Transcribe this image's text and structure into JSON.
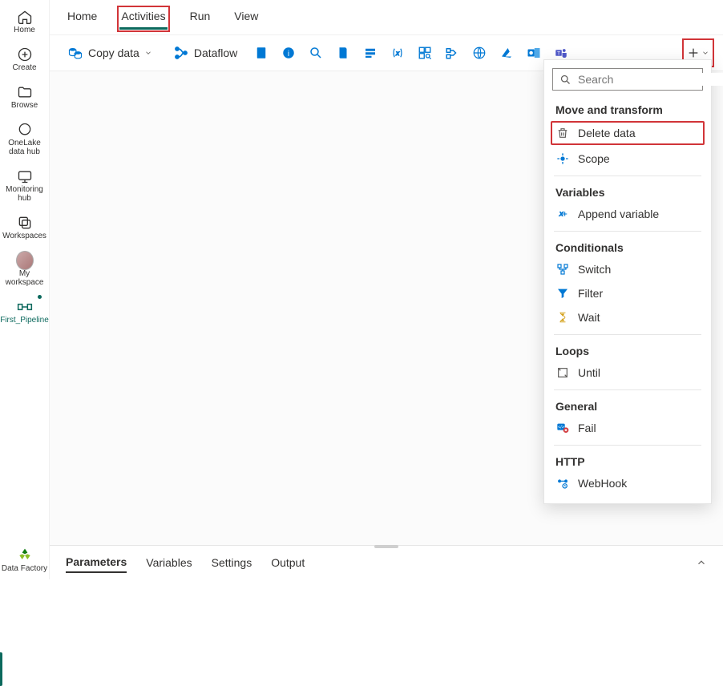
{
  "rail": {
    "items": [
      {
        "label": "Home"
      },
      {
        "label": "Create"
      },
      {
        "label": "Browse"
      },
      {
        "label": "OneLake data hub"
      },
      {
        "label": "Monitoring hub"
      },
      {
        "label": "Workspaces"
      },
      {
        "label": "My workspace"
      },
      {
        "label": "First_Pipeline"
      }
    ],
    "footer": "Data Factory"
  },
  "tabs": [
    "Home",
    "Activities",
    "Run",
    "View"
  ],
  "toolbar": {
    "copy": "Copy data",
    "dataflow": "Dataflow"
  },
  "panel": {
    "search_placeholder": "Search",
    "groups": [
      {
        "title": "Move and transform",
        "items": [
          "Delete data",
          "Scope"
        ]
      },
      {
        "title": "Variables",
        "items": [
          "Append variable"
        ]
      },
      {
        "title": "Conditionals",
        "items": [
          "Switch",
          "Filter",
          "Wait"
        ]
      },
      {
        "title": "Loops",
        "items": [
          "Until"
        ]
      },
      {
        "title": "General",
        "items": [
          "Fail"
        ]
      },
      {
        "title": "HTTP",
        "items": [
          "WebHook"
        ]
      }
    ]
  },
  "bottom": [
    "Parameters",
    "Variables",
    "Settings",
    "Output"
  ]
}
